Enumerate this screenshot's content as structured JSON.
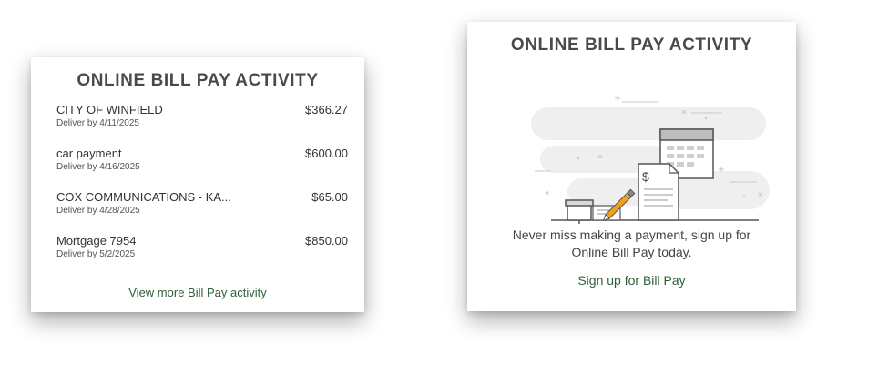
{
  "bill_pay_activity": {
    "title": "ONLINE BILL PAY ACTIVITY",
    "items": [
      {
        "payee": "CITY OF WINFIELD",
        "deliver": "Deliver by 4/11/2025",
        "amount": "$366.27"
      },
      {
        "payee": "car payment",
        "deliver": "Deliver by 4/16/2025",
        "amount": "$600.00"
      },
      {
        "payee": "COX COMMUNICATIONS - KA...",
        "deliver": "Deliver by 4/28/2025",
        "amount": "$65.00"
      },
      {
        "payee": "Mortgage 7954",
        "deliver": "Deliver by 5/2/2025",
        "amount": "$850.00"
      }
    ],
    "view_more_label": "View more Bill Pay activity"
  },
  "bill_pay_empty": {
    "title": "ONLINE BILL PAY ACTIVITY",
    "message_line1": "Never miss making a payment, sign up for",
    "message_line2": "Online Bill Pay today.",
    "signup_label": "Sign up for Bill Pay",
    "illustration_icon": "bill-pay-illustration-icon"
  },
  "colors": {
    "link_green": "#2f5f3a",
    "title_gray": "#4a4a4a",
    "pencil_orange": "#f0a020"
  }
}
